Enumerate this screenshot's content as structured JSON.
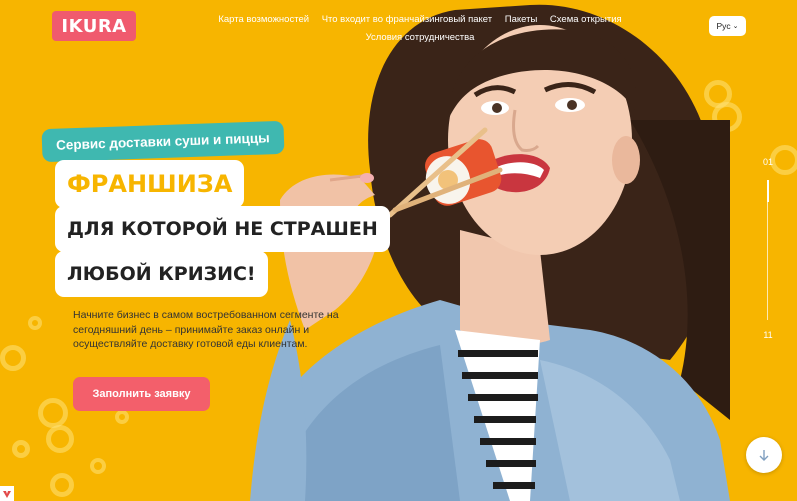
{
  "brand": {
    "logo_text": "IKURA",
    "logo_color": "#f05a6e"
  },
  "nav": {
    "items": [
      "Карта возможностей",
      "Что входит во франчайзинговый пакет",
      "Пакеты",
      "Схема открытия",
      "Условия сотрудничества"
    ]
  },
  "lang": {
    "label": "Рус",
    "icon": "chevron-down-icon"
  },
  "hero": {
    "service_label": "Сервис доставки суши и пиццы",
    "line1": "ФРАНШИЗА",
    "line2": "ДЛЯ КОТОРОЙ НЕ СТРАШЕН",
    "line3": "ЛЮБОЙ КРИЗИС!",
    "description": "Начните бизнес в самом востребованном сегменте на сегодняшний день – принимайте заказ онлайн и осуществляйте доставку готовой еды клиентам.",
    "cta_label": "Заполнить заявку"
  },
  "pager": {
    "current": "01",
    "total": "11"
  },
  "colors": {
    "background": "#f7b500",
    "accent_teal": "#3fb8b0",
    "cta": "#f35f6b"
  },
  "icons": {
    "scroll": "arrow-down-icon",
    "corner": "brand-mark-icon"
  }
}
